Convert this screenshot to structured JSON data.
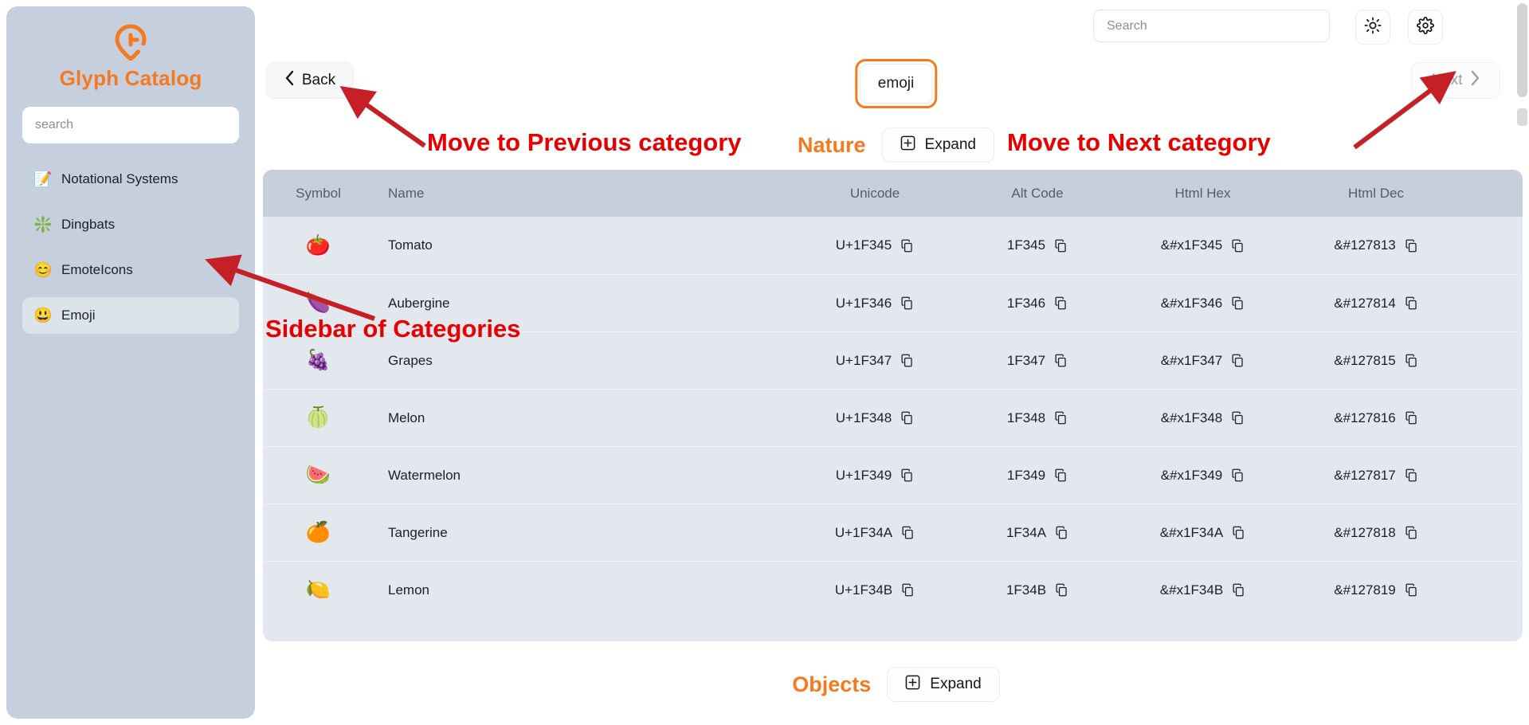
{
  "sidebar": {
    "brand_title": "Glyph Catalog",
    "logo_icon": "location-pin-g-logo",
    "search_placeholder": "search",
    "search_value": "",
    "items": [
      {
        "icon": "memo-icon",
        "glyph": "📝",
        "label": "Notational Systems",
        "active": false
      },
      {
        "icon": "dingbat-star-icon",
        "glyph": "❇️",
        "label": "Dingbats",
        "active": false
      },
      {
        "icon": "smiling-face-icon",
        "glyph": "😊",
        "label": "EmoteIcons",
        "active": false
      },
      {
        "icon": "grinning-face-icon",
        "glyph": "😃",
        "label": "Emoji",
        "active": true
      }
    ]
  },
  "topbar": {
    "search_placeholder": "Search",
    "search_value": "",
    "theme_toggle_icon": "sun-icon",
    "settings_icon": "gear-icon"
  },
  "navrow": {
    "back_label": "Back",
    "back_icon": "chevron-left-icon",
    "next_label": "Next",
    "next_icon": "chevron-right-icon",
    "next_disabled": true,
    "current_chip": "emoji",
    "chip_focus_color": "#f4791f"
  },
  "sections": [
    {
      "title": "Nature",
      "expand_label": "Expand",
      "expand_icon": "plus-square-icon"
    },
    {
      "title": "Objects",
      "expand_label": "Expand",
      "expand_icon": "plus-square-icon"
    }
  ],
  "table": {
    "headers": [
      "Symbol",
      "Name",
      "Unicode",
      "Alt Code",
      "Html Hex",
      "Html Dec"
    ],
    "copy_icon": "copy-icon",
    "rows": [
      {
        "symbol": "🍅",
        "name": "Tomato",
        "unicode": "U+1F345",
        "alt": "1F345",
        "hex": "&#x1F345",
        "dec": "&#127813"
      },
      {
        "symbol": "🍆",
        "name": "Aubergine",
        "unicode": "U+1F346",
        "alt": "1F346",
        "hex": "&#x1F346",
        "dec": "&#127814"
      },
      {
        "symbol": "🍇",
        "name": "Grapes",
        "unicode": "U+1F347",
        "alt": "1F347",
        "hex": "&#x1F347",
        "dec": "&#127815"
      },
      {
        "symbol": "🍈",
        "name": "Melon",
        "unicode": "U+1F348",
        "alt": "1F348",
        "hex": "&#x1F348",
        "dec": "&#127816"
      },
      {
        "symbol": "🍉",
        "name": "Watermelon",
        "unicode": "U+1F349",
        "alt": "1F349",
        "hex": "&#x1F349",
        "dec": "&#127817"
      },
      {
        "symbol": "🍊",
        "name": "Tangerine",
        "unicode": "U+1F34A",
        "alt": "1F34A",
        "hex": "&#x1F34A",
        "dec": "&#127818"
      },
      {
        "symbol": "🍋",
        "name": "Lemon",
        "unicode": "U+1F34B",
        "alt": "1F34B",
        "hex": "&#x1F34B",
        "dec": "&#127819"
      }
    ]
  },
  "annotations": {
    "previous": "Move to Previous category",
    "next": "Move to Next category",
    "sidebar": "Sidebar of Categories",
    "color": "#e60000"
  },
  "colors": {
    "accent": "#f4791f",
    "sidebar_bg": "#c5cfdd",
    "table_header_bg": "#c6cfdb",
    "table_body_bg": "#e3e8ef"
  }
}
